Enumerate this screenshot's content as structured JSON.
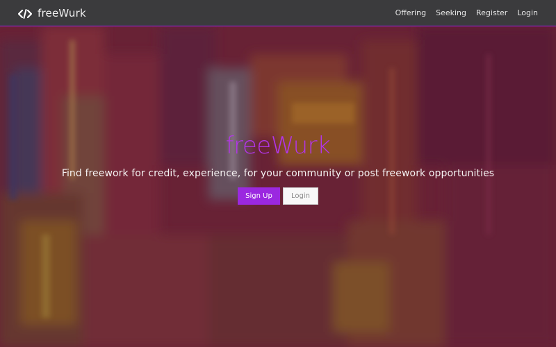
{
  "navbar": {
    "brand_name": "freeWurk",
    "brand_icon": "code-icon",
    "links": [
      {
        "label": "Offering"
      },
      {
        "label": "Seeking"
      },
      {
        "label": "Register"
      },
      {
        "label": "Login"
      }
    ]
  },
  "hero": {
    "title": "freeWurk",
    "tagline": "Find freework for credit, experience, for your community or post freework opportunities",
    "buttons": {
      "signup_label": "Sign Up",
      "login_label": "Login"
    }
  },
  "colors": {
    "accent": "#9b28e0",
    "navbar_bg": "#3b3b3d",
    "title": "#b235e8"
  }
}
